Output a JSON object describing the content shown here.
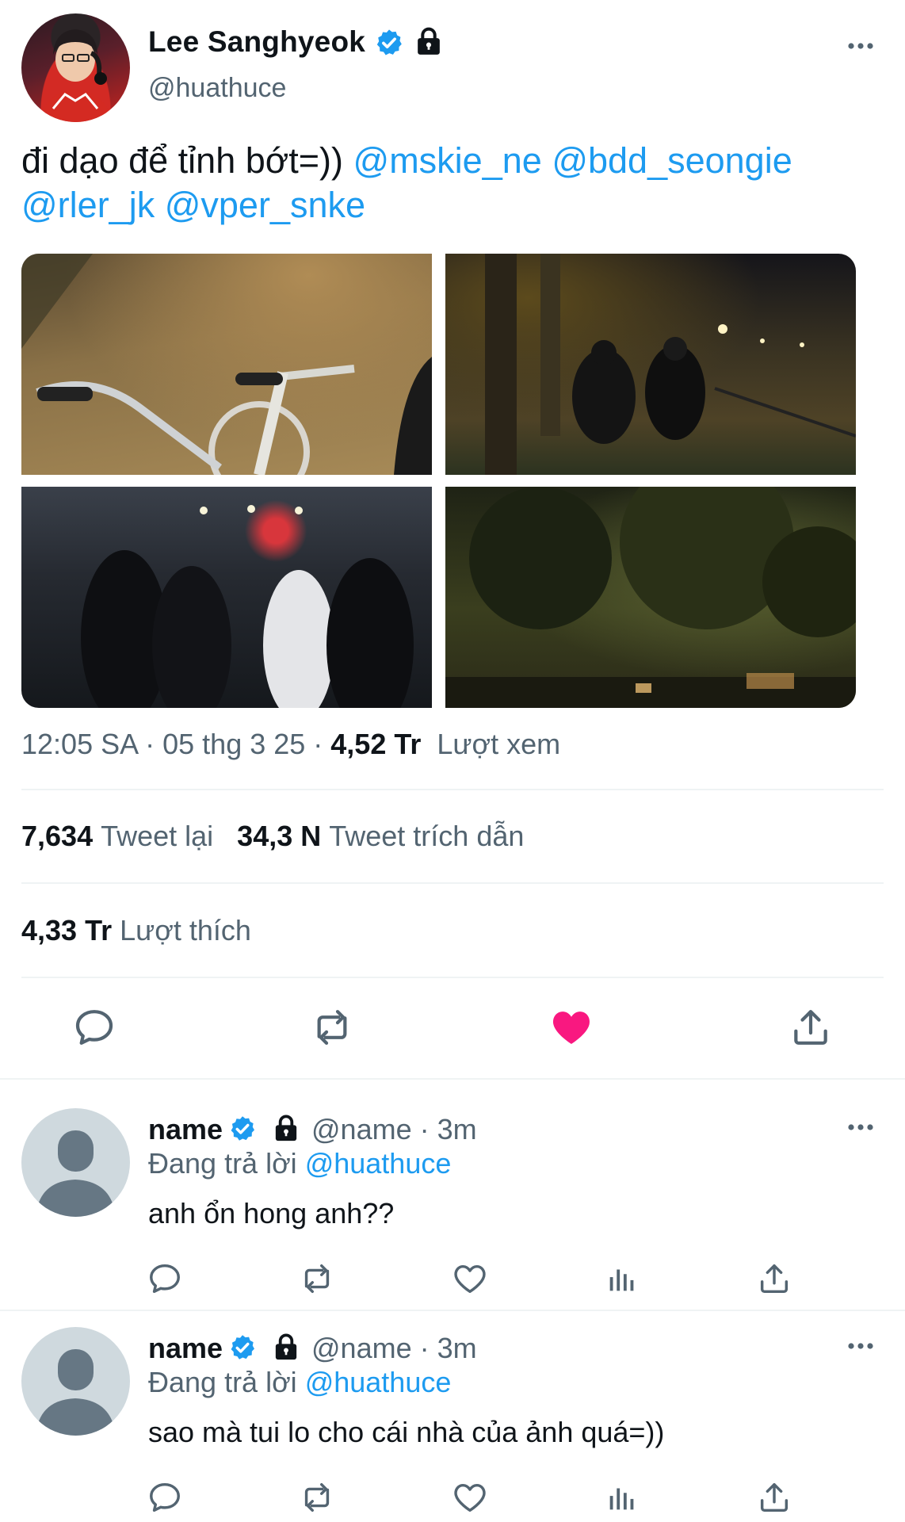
{
  "tweet": {
    "author_name": "Lee Sanghyeok",
    "handle": "@huathuce",
    "text": "đi dạo để tỉnh bớt=)) ",
    "mentions": [
      "@mskie_ne",
      "@bdd_seongie",
      "@rler_jk",
      "@vper_snke"
    ],
    "timestamp": "12:05 SA · 05 thg 3 25 · ",
    "views_count": "4,52 Tr",
    "views_label": "Lượt xem",
    "retweets_count": "7,634",
    "retweets_label": "Tweet lại",
    "quotes_count": "34,3 N",
    "quotes_label": "Tweet trích dẫn",
    "likes_count": "4,33 Tr",
    "likes_label": "Lượt thích",
    "liked": true,
    "icons": [
      "verified-badge-icon",
      "lock-icon",
      "more-icon",
      "reply-icon",
      "retweet-icon",
      "heart-filled-icon",
      "share-icon"
    ]
  },
  "replies": [
    {
      "name": "name",
      "handle_time": "@name · 3m",
      "replying_prefix": "Đang trả lời ",
      "replying_to": "@huathuce",
      "text": "anh ổn hong anh??"
    },
    {
      "name": "name",
      "handle_time": "@name · 3m",
      "replying_prefix": "Đang trả lời ",
      "replying_to": "@huathuce",
      "text": "sao mà tui lo cho cái nhà của ảnh quá=))"
    }
  ],
  "colors": {
    "accent": "#1d9bf0",
    "like": "#f91880",
    "text_primary": "#0f1419",
    "text_secondary": "#536471",
    "divider": "#eff3f4",
    "default_avatar": "#cfd9de"
  }
}
